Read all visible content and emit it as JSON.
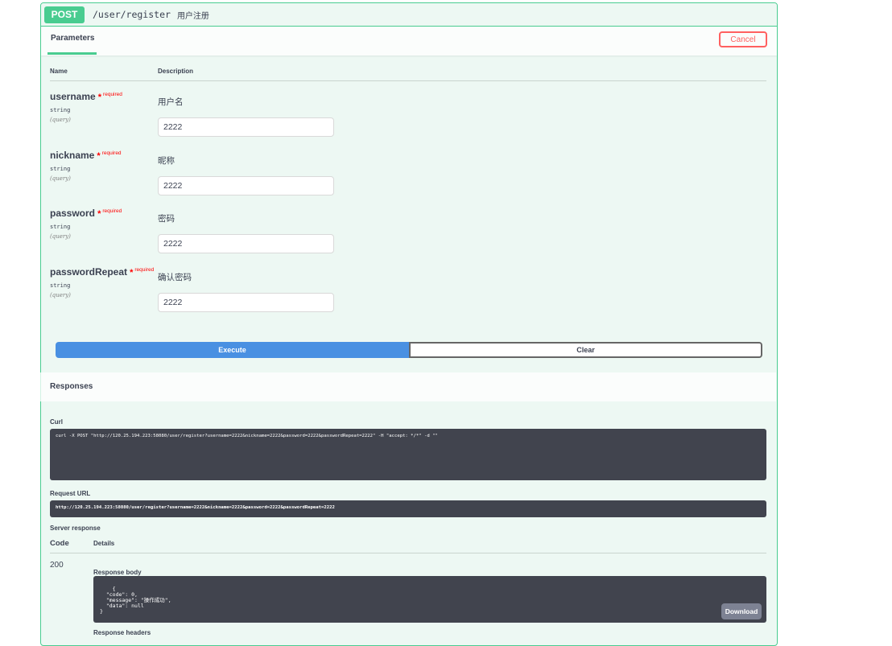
{
  "summary": {
    "method": "POST",
    "path": "/user/register",
    "description": "用户注册"
  },
  "header": {
    "tab_label": "Parameters",
    "cancel_label": "Cancel"
  },
  "columns": {
    "name": "Name",
    "description": "Description"
  },
  "required_label": "required",
  "parameters": [
    {
      "name": "username",
      "type": "string",
      "in": "(query)",
      "description": "用户名",
      "value": "2222"
    },
    {
      "name": "nickname",
      "type": "string",
      "in": "(query)",
      "description": "昵称",
      "value": "2222"
    },
    {
      "name": "password",
      "type": "string",
      "in": "(query)",
      "description": "密码",
      "value": "2222"
    },
    {
      "name": "passwordRepeat",
      "type": "string",
      "in": "(query)",
      "description": "确认密码",
      "value": "2222"
    }
  ],
  "actions": {
    "execute_label": "Execute",
    "clear_label": "Clear"
  },
  "responses": {
    "title": "Responses",
    "curl_label": "Curl",
    "curl_command": "curl -X POST \"http://120.25.194.223:58080/user/register?username=2222&nickname=2222&password=2222&passwordRepeat=2222\" -H \"accept: */*\" -d \"\"",
    "request_url_label": "Request URL",
    "request_url": "http://120.25.194.223:58080/user/register?username=2222&nickname=2222&password=2222&passwordRepeat=2222",
    "server_response_label": "Server response",
    "code_col": "Code",
    "details_col": "Details",
    "status_code": "200",
    "response_body_label": "Response body",
    "response_body": "{\n  \"code\": 0,\n  \"message\": \"操作成功\",\n  \"data\": null\n}",
    "download_label": "Download",
    "response_headers_label": "Response headers"
  }
}
